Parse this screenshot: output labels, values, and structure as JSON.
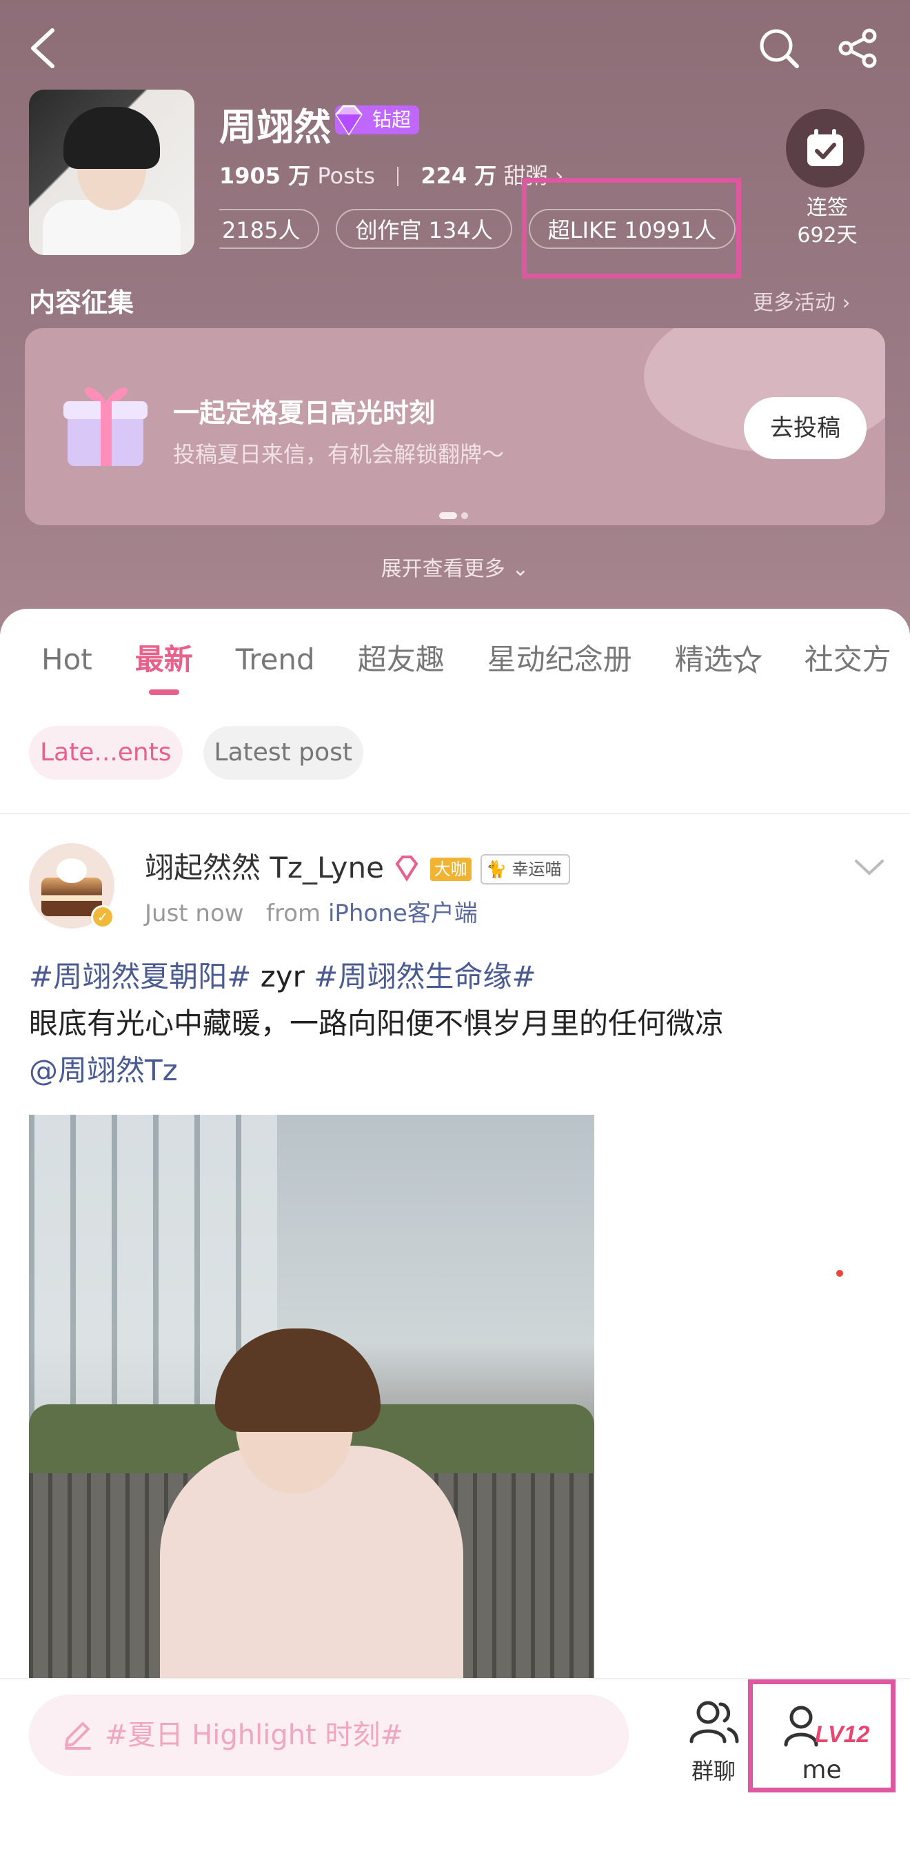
{
  "header": {
    "name": "周翊然",
    "vip_label": "钻超",
    "stats": {
      "posts_count": "1905 万",
      "posts_label": "Posts",
      "fans_count": "224 万",
      "fans_label": "甜粥 ›"
    },
    "chips": [
      "2185人",
      "创作官 134人",
      "超LIKE 10991人"
    ],
    "checkin": {
      "label": "连签",
      "days": "692天"
    }
  },
  "section": {
    "title": "内容征集",
    "more": "更多活动 ›"
  },
  "banner": {
    "title": "一起定格夏日高光时刻",
    "subtitle": "投稿夏日来信，有机会解锁翻牌～",
    "button": "去投稿"
  },
  "expand": {
    "label": "展开查看更多 ⌄"
  },
  "tabs": [
    "Hot",
    "最新",
    "Trend",
    "超友趣",
    "星动纪念册",
    "精选",
    "社交方"
  ],
  "active_tab": "最新",
  "filters": [
    "Late...ents",
    "Latest post"
  ],
  "post": {
    "username": "翊起然然 Tz_Lyne",
    "badge_big": "大咖",
    "badge_lucky": "幸运喵",
    "time": "Just now",
    "from_label": "from",
    "client": "iPhone客户端",
    "hashtag1": "#周翊然夏朝阳#",
    "plain1": " zyr ",
    "hashtag2": "#周翊然生命缘#",
    "line2": "眼底有光心中藏暖，一路向阳便不惧岁月里的任何微凉",
    "mention": "@周翊然Tz"
  },
  "bottom": {
    "compose_placeholder": "#夏日 Highlight 时刻#",
    "group_label": "群聊",
    "me_label": "me",
    "level": "LV12"
  },
  "colors": {
    "accent": "#e8618c",
    "highlight_box": "#de58a0",
    "vip": "#c067ff"
  }
}
